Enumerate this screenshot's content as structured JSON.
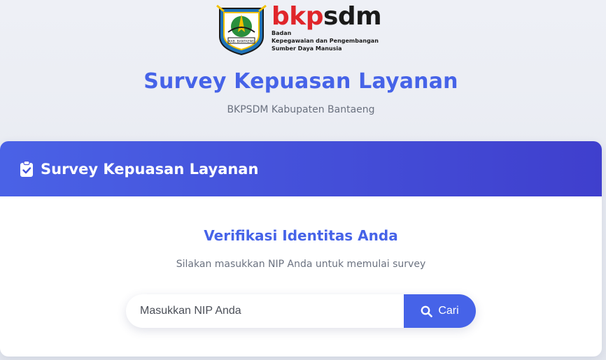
{
  "header": {
    "brand_prefix": "bkp",
    "brand_suffix": "sdm",
    "brand_sub_line1": "Badan",
    "brand_sub_line2": "Kepegawaian dan Pengembangan",
    "brand_sub_line3": "Sumber Daya Manusia",
    "emblem_caption": "KAB. BANTAENG",
    "title": "Survey Kepuasan Layanan",
    "subtitle": "BKPSDM Kabupaten Bantaeng"
  },
  "card": {
    "title": "Survey Kepuasan Layanan",
    "title_icon": "clipboard-check-icon",
    "verify_title": "Verifikasi Identitas Anda",
    "verify_subtitle": "Silakan masukkan NIP Anda untuk memulai survey",
    "nip_input": {
      "value": "",
      "placeholder": "Masukkan NIP Anda"
    },
    "search_button": {
      "label": "Cari",
      "icon": "search-icon"
    }
  },
  "colors": {
    "accent": "#4663e8",
    "header_gradient_start": "#4a62e6",
    "header_gradient_end": "#3f3fcd",
    "brand_red": "#e0262b"
  }
}
